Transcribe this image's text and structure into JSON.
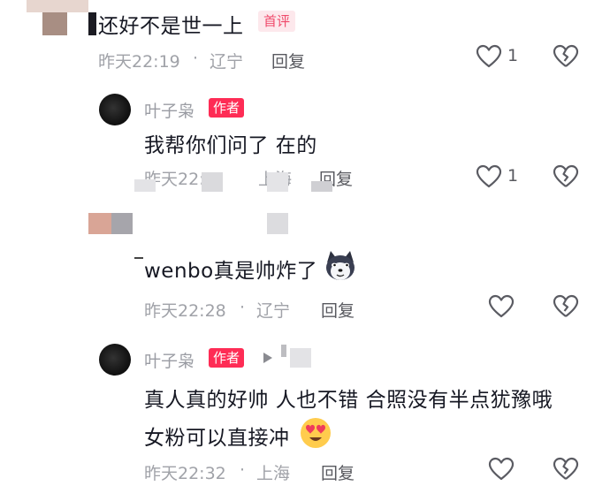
{
  "colors": {
    "accent": "#fe2c55",
    "meta_text": "#a0a2a8",
    "body_text": "#161823",
    "icon": "#5a5b62"
  },
  "comment1": {
    "text": "还好不是世一上",
    "first_badge": "首评",
    "time": "昨天22:19",
    "location": "辽宁",
    "reply": "回复",
    "like_count": "1",
    "icons": [
      "heart-icon",
      "broken-heart-icon"
    ]
  },
  "reply1": {
    "username": "叶子枭",
    "author_badge": "作者",
    "text": "我帮你们问了  在的",
    "time": "昨天22:··",
    "location": "上海",
    "reply": "回复",
    "like_count": "1"
  },
  "comment2": {
    "text_prefix": "wenbo真是帅炸了",
    "time": "昨天22:28",
    "location": "辽宁",
    "reply": "回复",
    "emoji": "husky-dog-emoji"
  },
  "reply2": {
    "username": "叶子枭",
    "author_badge": "作者",
    "text_line1": "真人真的好帅  人也不错 合照没有半点犹豫哦",
    "text_line2": "女粉可以直接冲",
    "time": "昨天22:32",
    "location": "上海",
    "reply": "回复",
    "emoji": "heart-eyes-emoji"
  },
  "separator": "·"
}
